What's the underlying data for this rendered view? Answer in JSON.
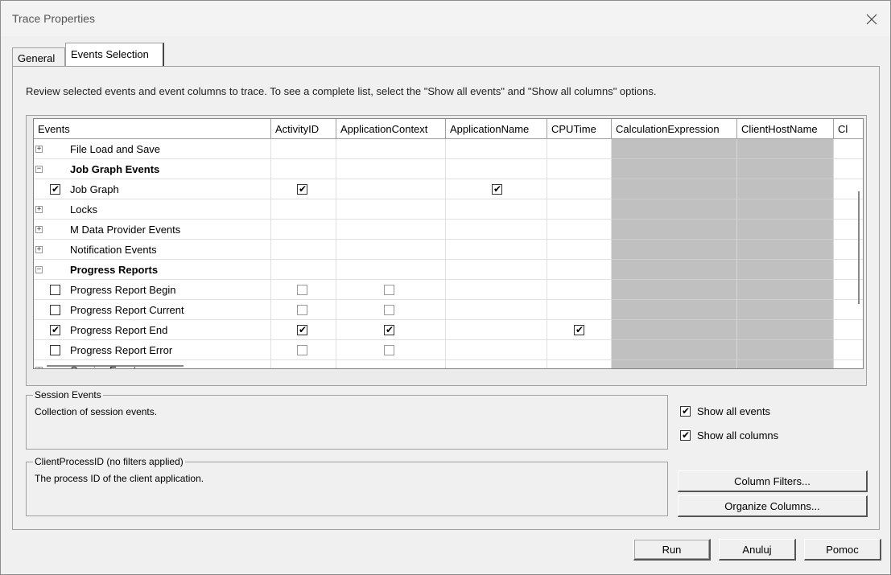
{
  "window": {
    "title": "Trace Properties"
  },
  "tabs": [
    {
      "label": "General"
    },
    {
      "label": "Events Selection"
    }
  ],
  "instruction": "Review selected events and event columns to trace. To see a complete list, select the \"Show all events\" and \"Show all columns\" options.",
  "grid": {
    "columns": [
      "Events",
      "ActivityID",
      "ApplicationContext",
      "ApplicationName",
      "CPUTime",
      "CalculationExpression",
      "ClientHostName",
      "Cl"
    ],
    "rows": [
      {
        "label": "File Load and Save",
        "type": "category",
        "expanded": false,
        "checks": []
      },
      {
        "label": "Job Graph Events",
        "type": "category",
        "expanded": true,
        "bold": true,
        "checks": []
      },
      {
        "label": "Job Graph",
        "type": "event",
        "checked": true,
        "checks": [
          "true",
          "",
          "true",
          ""
        ]
      },
      {
        "label": "Locks",
        "type": "category",
        "expanded": false,
        "checks": []
      },
      {
        "label": "M Data Provider Events",
        "type": "category",
        "expanded": false,
        "checks": []
      },
      {
        "label": "Notification Events",
        "type": "category",
        "expanded": false,
        "checks": []
      },
      {
        "label": "Progress Reports",
        "type": "category",
        "expanded": true,
        "bold": true,
        "checks": []
      },
      {
        "label": "Progress Report Begin",
        "type": "event",
        "checked": false,
        "checks": [
          "false",
          "false",
          "",
          ""
        ]
      },
      {
        "label": "Progress Report Current",
        "type": "event",
        "checked": false,
        "checks": [
          "false",
          "false",
          "",
          ""
        ]
      },
      {
        "label": "Progress Report End",
        "type": "event",
        "checked": true,
        "checks": [
          "true",
          "true",
          "",
          "true"
        ]
      },
      {
        "label": "Progress Report Error",
        "type": "event",
        "checked": false,
        "checks": [
          "false",
          "false",
          "",
          ""
        ]
      },
      {
        "label": "Queries Events",
        "type": "category",
        "expanded": false,
        "checks": []
      }
    ]
  },
  "session_events": {
    "title": "Session Events",
    "description": "Collection of session events."
  },
  "column_info": {
    "title": "ClientProcessID (no filters applied)",
    "description": "The process ID of the client application."
  },
  "options": {
    "show_all_events": {
      "label": "Show all events",
      "checked": true
    },
    "show_all_columns": {
      "label": "Show all columns",
      "checked": true
    }
  },
  "buttons": {
    "column_filters": "Column Filters...",
    "organize_columns": "Organize Columns...",
    "run": "Run",
    "cancel": "Anuluj",
    "help": "Pomoc"
  },
  "icons": {
    "close": "close-icon",
    "expand": "plus-icon",
    "collapse": "minus-icon",
    "check": "checkmark-icon"
  },
  "colors": {
    "disabled_column": "#c0c0c0",
    "window_bg": "#f0f0f0"
  }
}
